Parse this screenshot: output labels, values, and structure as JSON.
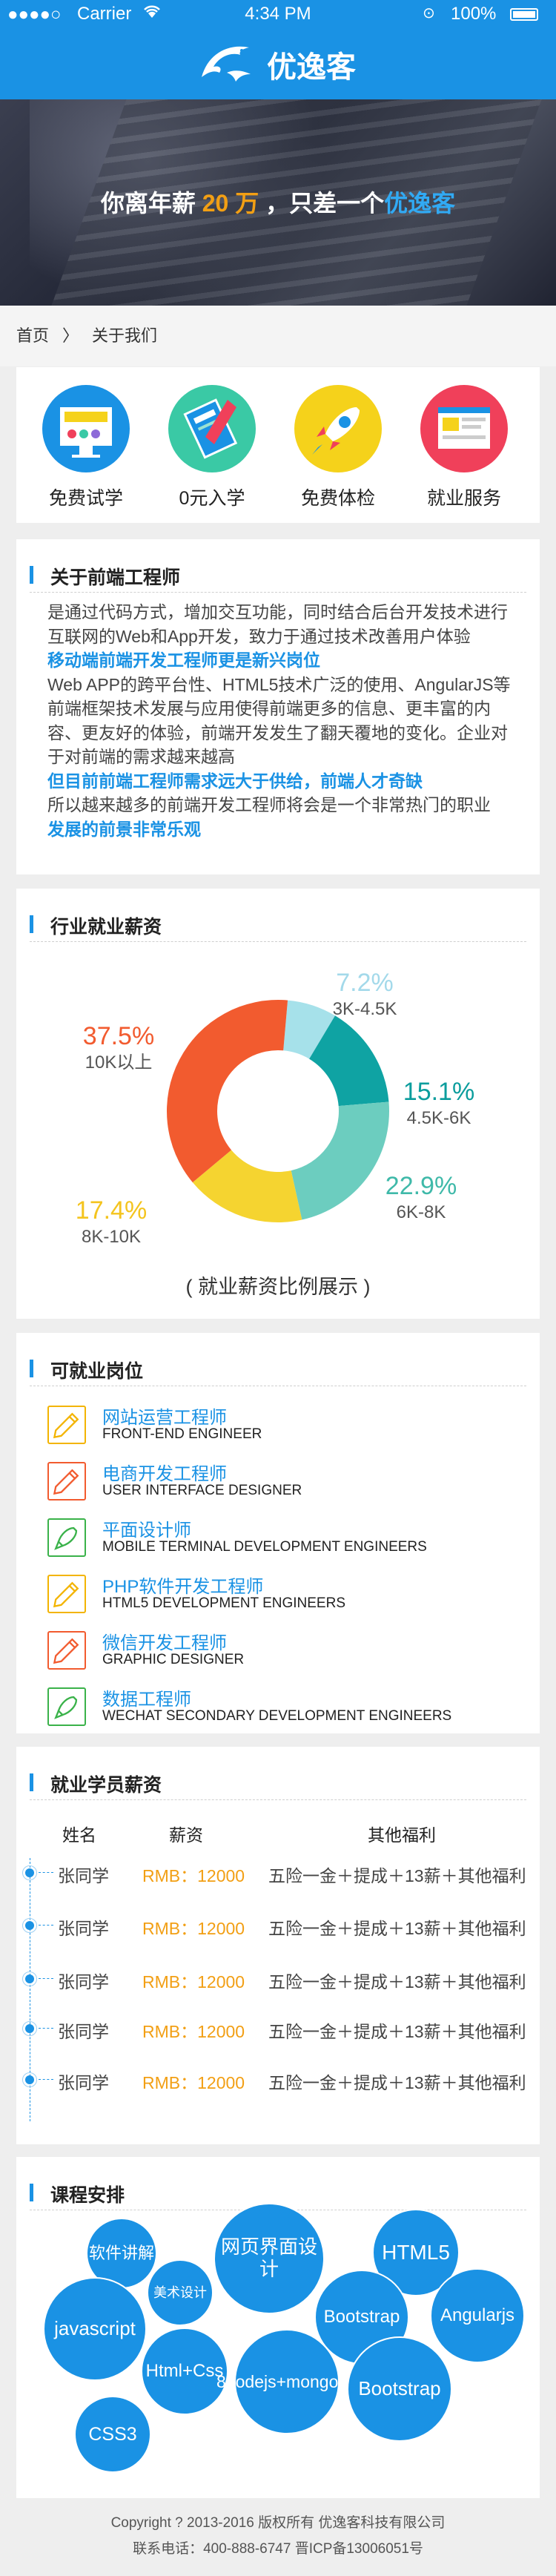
{
  "status_bar": {
    "signal": "●●●●○",
    "carrier": "Carrier",
    "time": "4:34 PM",
    "battery": "100%"
  },
  "header": {
    "title": "优逸客"
  },
  "banner": {
    "text_1": "你离年薪",
    "salary": "20 万",
    "text_2": "，只差一个",
    "brand": "优逸客"
  },
  "breadcrumb": {
    "home": "首页",
    "separator": "〉",
    "current": "关于我们"
  },
  "features": [
    {
      "label": "免费试学",
      "icon": "monitor-icon",
      "color": "#1a92e4"
    },
    {
      "label": "0元入学",
      "icon": "book-icon",
      "color": "#3ac9a5"
    },
    {
      "label": "免费体检",
      "icon": "rocket-icon",
      "color": "#f5d21b"
    },
    {
      "label": "就业服务",
      "icon": "webpage-icon",
      "color": "#f0405a"
    }
  ],
  "about": {
    "title": "关于前端工程师",
    "p1": "是通过代码方式，增加交互功能，同时结合后台开发技术进行互联网的Web和App开发，致力于通过技术改善用户体验",
    "h1": "移动端前端开发工程师更是新兴岗位",
    "p2": "Web APP的跨平台性、HTML5技术广泛的使用、AngularJS等前端框架技术发展与应用使得前端更多的信息、更丰富的内容、更友好的体验，前端开发发生了翻天覆地的变化。企业对于对前端的需求越来越高",
    "h2": "但目前前端工程师需求远大于供给，前端人才奇缺",
    "p3": "所以越来越多的前端开发工程师将会是一个非常热门的职业",
    "h3": "发展的前景非常乐观"
  },
  "salary": {
    "title": "行业就业薪资",
    "caption": "( 就业薪资比例展示 )",
    "chart_data": {
      "type": "pie",
      "categories": [
        "3K-4.5K",
        "4.5K-6K",
        "6K-8K",
        "8K-10K",
        "10K以上"
      ],
      "values": [
        7.2,
        15.1,
        22.9,
        17.4,
        37.5
      ],
      "labels": [
        "7.2%",
        "15.1%",
        "22.9%",
        "17.4%",
        "37.5%"
      ],
      "colors": [
        "#a6e1ea",
        "#0fa3a3",
        "#6ccdbf",
        "#f5d430",
        "#f25b2f"
      ],
      "label_colors": [
        "#a3d9ea",
        "#0c9d9d",
        "#3fb9a9",
        "#f4c41e",
        "#f25b2f"
      ]
    }
  },
  "jobs": {
    "title": "可就业岗位",
    "items": [
      {
        "cn": "网站运营工程师",
        "en": "FRONT-END ENGINEER",
        "icon": "pencil-icon",
        "color": "#f3b400"
      },
      {
        "cn": "电商开发工程师",
        "en": "USER INTERFACE DESIGNER",
        "icon": "pen-icon",
        "color": "#f25b2f"
      },
      {
        "cn": "平面设计师",
        "en": "MOBILE TERMINAL DEVELOPMENT ENGINEERS",
        "icon": "rocket-icon",
        "color": "#3ab24a"
      },
      {
        "cn": "PHP软件开发工程师",
        "en": "HTML5 DEVELOPMENT ENGINEERS",
        "icon": "pencil-icon",
        "color": "#f3b400"
      },
      {
        "cn": "微信开发工程师",
        "en": "GRAPHIC DESIGNER",
        "icon": "pen-icon",
        "color": "#f25b2f"
      },
      {
        "cn": "数据工程师",
        "en": "WECHAT SECONDARY DEVELOPMENT ENGINEERS",
        "icon": "rocket-icon",
        "color": "#3ab24a"
      }
    ]
  },
  "students": {
    "title": "就业学员薪资",
    "columns": [
      "姓名",
      "薪资",
      "其他福利"
    ],
    "rows": [
      {
        "name": "张同学",
        "salary": "RMB：12000",
        "benefit": "五险一金＋提成＋13薪＋其他福利"
      },
      {
        "name": "张同学",
        "salary": "RMB：12000",
        "benefit": "五险一金＋提成＋13薪＋其他福利"
      },
      {
        "name": "张同学",
        "salary": "RMB：12000",
        "benefit": "五险一金＋提成＋13薪＋其他福利"
      },
      {
        "name": "张同学",
        "salary": "RMB：12000",
        "benefit": "五险一金＋提成＋13薪＋其他福利"
      },
      {
        "name": "张同学",
        "salary": "RMB：12000",
        "benefit": "五险一金＋提成＋13薪＋其他福利"
      }
    ]
  },
  "courses": {
    "title": "课程安排",
    "bubbles": [
      "软件讲解",
      "网页界面设计",
      "HTML5",
      "美术设计",
      "javascript",
      "Bootstrap",
      "Angularjs",
      "Html+Css",
      "8nodejs+mongodb",
      "Bootstrap",
      "CSS3"
    ]
  },
  "footer": {
    "copyright": "Copyright ? 2013-2016 版权所有 优逸客科技有限公司",
    "contact": "联系电话：400-888-6747 晋ICP备13006051号"
  },
  "colors": {
    "primary": "#1a92e4",
    "accent": "#f29f14"
  }
}
